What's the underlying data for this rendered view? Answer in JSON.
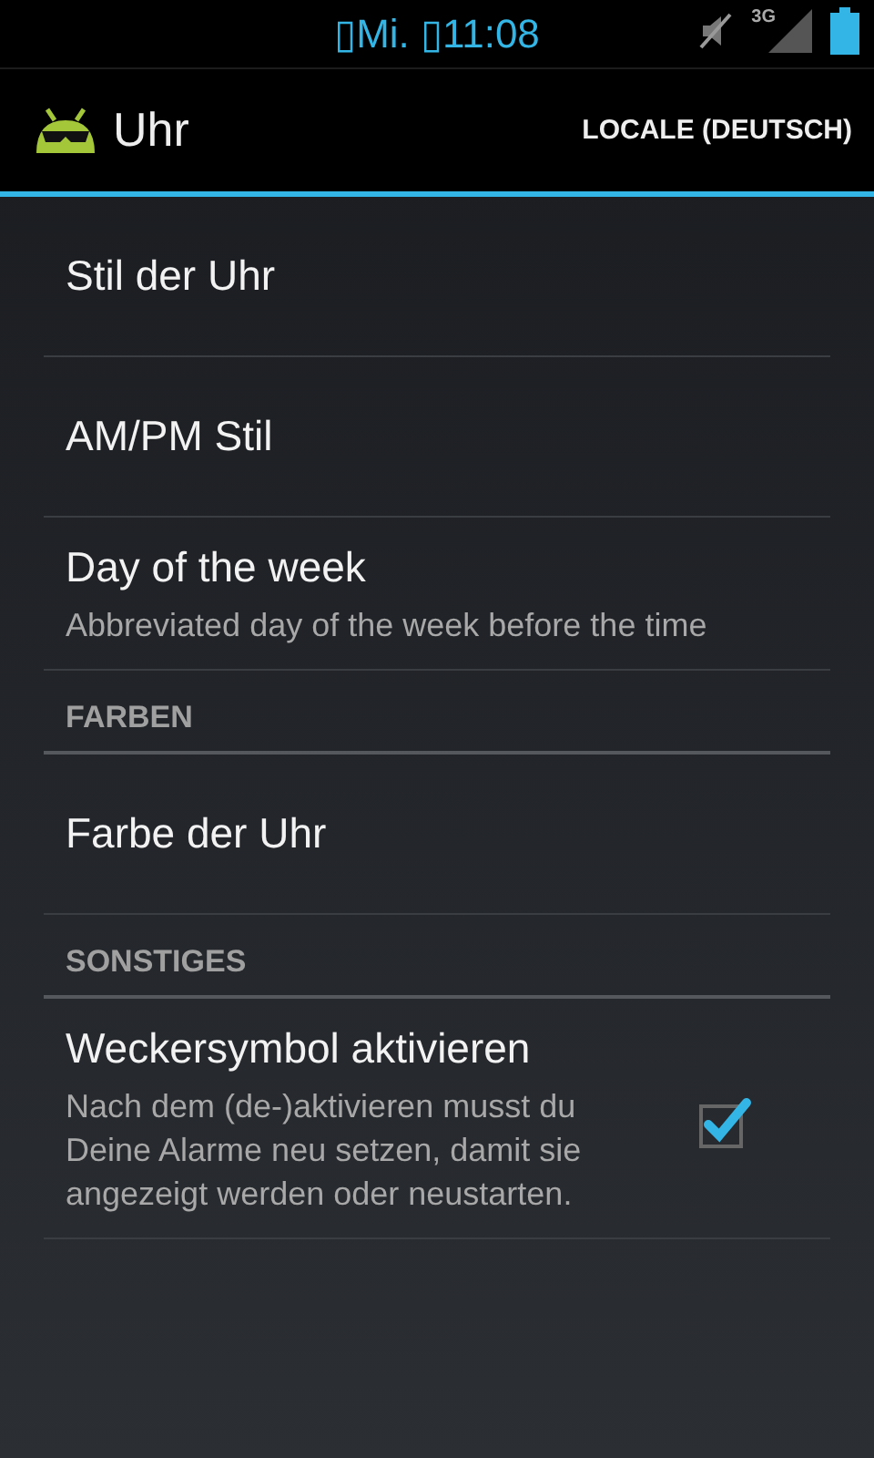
{
  "status_bar": {
    "clock": "▯Mi. ▯11:08",
    "network": "3G"
  },
  "action_bar": {
    "title": "Uhr",
    "action": "LOCALE (DEUTSCH)"
  },
  "preferences": [
    {
      "kind": "preference",
      "title": "Stil der Uhr"
    },
    {
      "kind": "preference",
      "title": "AM/PM Stil"
    },
    {
      "kind": "preference",
      "title": "Day of the week",
      "summary": "Abbreviated day of the week before the time"
    },
    {
      "kind": "category",
      "title": "FARBEN"
    },
    {
      "kind": "preference",
      "title": "Farbe der Uhr"
    },
    {
      "kind": "category",
      "title": "SONSTIGES"
    },
    {
      "kind": "checkbox",
      "title": "Weckersymbol aktivieren",
      "summary": "Nach dem (de-)aktivieren musst du Deine Alarme neu setzen, damit sie angezeigt werden oder neustarten.",
      "checked": true
    }
  ]
}
